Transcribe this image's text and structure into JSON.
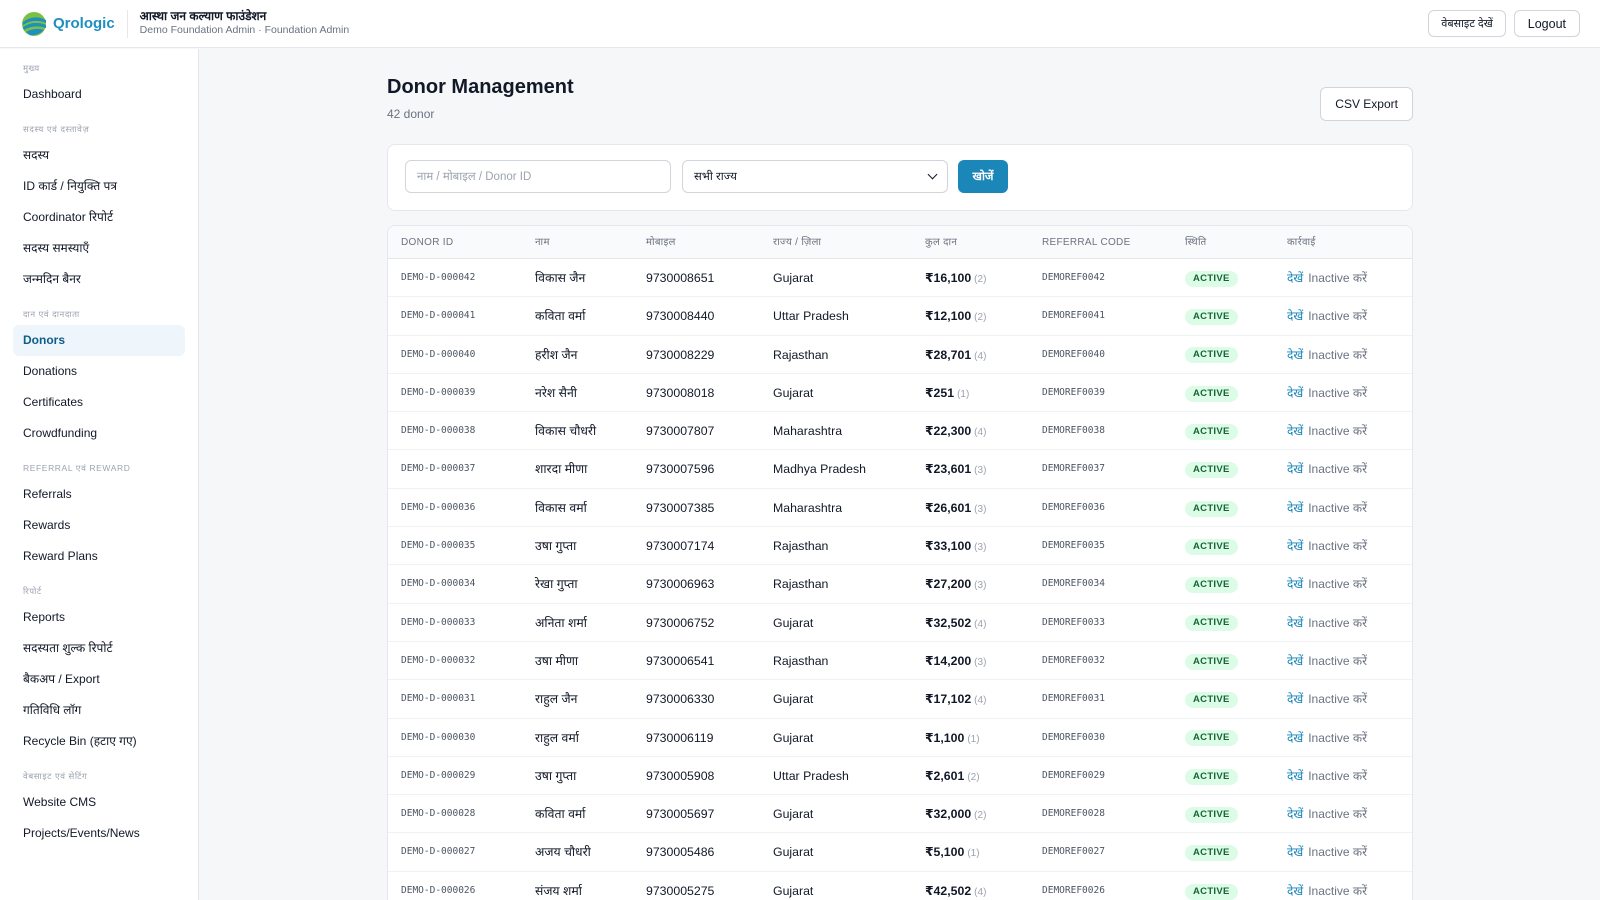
{
  "header": {
    "logo_text": "Qrologic",
    "org_name": "आस्था जन कल्याण फाउंडेशन",
    "org_role": "Demo Foundation Admin · Foundation Admin",
    "website_button": "वेबसाइट देखें",
    "logout_button": "Logout"
  },
  "sidebar": {
    "sections": [
      {
        "title": "मुख्य",
        "items": [
          {
            "label": "Dashboard",
            "active": false
          }
        ]
      },
      {
        "title": "सदस्य एवं दस्तावेज़",
        "items": [
          {
            "label": "सदस्य",
            "active": false
          },
          {
            "label": "ID कार्ड / नियुक्ति पत्र",
            "active": false
          },
          {
            "label": "Coordinator रिपोर्ट",
            "active": false
          },
          {
            "label": "सदस्य समस्याएँ",
            "active": false
          },
          {
            "label": "जन्मदिन बैनर",
            "active": false
          }
        ]
      },
      {
        "title": "दान एवं दानदाता",
        "items": [
          {
            "label": "Donors",
            "active": true
          },
          {
            "label": "Donations",
            "active": false
          },
          {
            "label": "Certificates",
            "active": false
          },
          {
            "label": "Crowdfunding",
            "active": false
          }
        ]
      },
      {
        "title": "REFERRAL एवं REWARD",
        "items": [
          {
            "label": "Referrals",
            "active": false
          },
          {
            "label": "Rewards",
            "active": false
          },
          {
            "label": "Reward Plans",
            "active": false
          }
        ]
      },
      {
        "title": "रिपोर्ट",
        "items": [
          {
            "label": "Reports",
            "active": false
          },
          {
            "label": "सदस्यता शुल्क रिपोर्ट",
            "active": false
          },
          {
            "label": "बैकअप / Export",
            "active": false
          },
          {
            "label": "गतिविधि लॉग",
            "active": false
          },
          {
            "label": "Recycle Bin (हटाए गए)",
            "active": false
          }
        ]
      },
      {
        "title": "वेबसाइट एवं सेटिंग",
        "items": [
          {
            "label": "Website CMS",
            "active": false
          },
          {
            "label": "Projects/Events/News",
            "active": false
          }
        ]
      }
    ]
  },
  "page": {
    "title": "Donor Management",
    "subtitle": "42 donor",
    "csv_button": "CSV Export"
  },
  "filters": {
    "search_placeholder": "नाम / मोबाइल / Donor ID",
    "state_value": "सभी राज्य",
    "search_button": "खोजें"
  },
  "table": {
    "columns": [
      "DONOR ID",
      "नाम",
      "मोबाइल",
      "राज्य / ज़िला",
      "कुल दान",
      "REFERRAL CODE",
      "स्थिति",
      "कार्रवाई"
    ],
    "view_label": "देखें",
    "inactive_label": "Inactive करें",
    "rows": [
      {
        "id": "DEMO-D-000042",
        "name": "विकास जैन",
        "mobile": "9730008651",
        "state": "Gujarat",
        "amount": "₹16,100",
        "count": "(2)",
        "ref": "DEMOREF0042",
        "status": "ACTIVE"
      },
      {
        "id": "DEMO-D-000041",
        "name": "कविता वर्मा",
        "mobile": "9730008440",
        "state": "Uttar Pradesh",
        "amount": "₹12,100",
        "count": "(2)",
        "ref": "DEMOREF0041",
        "status": "ACTIVE"
      },
      {
        "id": "DEMO-D-000040",
        "name": "हरीश जैन",
        "mobile": "9730008229",
        "state": "Rajasthan",
        "amount": "₹28,701",
        "count": "(4)",
        "ref": "DEMOREF0040",
        "status": "ACTIVE"
      },
      {
        "id": "DEMO-D-000039",
        "name": "नरेश सैनी",
        "mobile": "9730008018",
        "state": "Gujarat",
        "amount": "₹251",
        "count": "(1)",
        "ref": "DEMOREF0039",
        "status": "ACTIVE"
      },
      {
        "id": "DEMO-D-000038",
        "name": "विकास चौधरी",
        "mobile": "9730007807",
        "state": "Maharashtra",
        "amount": "₹22,300",
        "count": "(4)",
        "ref": "DEMOREF0038",
        "status": "ACTIVE"
      },
      {
        "id": "DEMO-D-000037",
        "name": "शारदा मीणा",
        "mobile": "9730007596",
        "state": "Madhya Pradesh",
        "amount": "₹23,601",
        "count": "(3)",
        "ref": "DEMOREF0037",
        "status": "ACTIVE"
      },
      {
        "id": "DEMO-D-000036",
        "name": "विकास वर्मा",
        "mobile": "9730007385",
        "state": "Maharashtra",
        "amount": "₹26,601",
        "count": "(3)",
        "ref": "DEMOREF0036",
        "status": "ACTIVE"
      },
      {
        "id": "DEMO-D-000035",
        "name": "उषा गुप्ता",
        "mobile": "9730007174",
        "state": "Rajasthan",
        "amount": "₹33,100",
        "count": "(3)",
        "ref": "DEMOREF0035",
        "status": "ACTIVE"
      },
      {
        "id": "DEMO-D-000034",
        "name": "रेखा गुप्ता",
        "mobile": "9730006963",
        "state": "Rajasthan",
        "amount": "₹27,200",
        "count": "(3)",
        "ref": "DEMOREF0034",
        "status": "ACTIVE"
      },
      {
        "id": "DEMO-D-000033",
        "name": "अनिता शर्मा",
        "mobile": "9730006752",
        "state": "Gujarat",
        "amount": "₹32,502",
        "count": "(4)",
        "ref": "DEMOREF0033",
        "status": "ACTIVE"
      },
      {
        "id": "DEMO-D-000032",
        "name": "उषा मीणा",
        "mobile": "9730006541",
        "state": "Rajasthan",
        "amount": "₹14,200",
        "count": "(3)",
        "ref": "DEMOREF0032",
        "status": "ACTIVE"
      },
      {
        "id": "DEMO-D-000031",
        "name": "राहुल जैन",
        "mobile": "9730006330",
        "state": "Gujarat",
        "amount": "₹17,102",
        "count": "(4)",
        "ref": "DEMOREF0031",
        "status": "ACTIVE"
      },
      {
        "id": "DEMO-D-000030",
        "name": "राहुल वर्मा",
        "mobile": "9730006119",
        "state": "Gujarat",
        "amount": "₹1,100",
        "count": "(1)",
        "ref": "DEMOREF0030",
        "status": "ACTIVE"
      },
      {
        "id": "DEMO-D-000029",
        "name": "उषा गुप्ता",
        "mobile": "9730005908",
        "state": "Uttar Pradesh",
        "amount": "₹2,601",
        "count": "(2)",
        "ref": "DEMOREF0029",
        "status": "ACTIVE"
      },
      {
        "id": "DEMO-D-000028",
        "name": "कविता वर्मा",
        "mobile": "9730005697",
        "state": "Gujarat",
        "amount": "₹32,000",
        "count": "(2)",
        "ref": "DEMOREF0028",
        "status": "ACTIVE"
      },
      {
        "id": "DEMO-D-000027",
        "name": "अजय चौधरी",
        "mobile": "9730005486",
        "state": "Gujarat",
        "amount": "₹5,100",
        "count": "(1)",
        "ref": "DEMOREF0027",
        "status": "ACTIVE"
      },
      {
        "id": "DEMO-D-000026",
        "name": "संजय शर्मा",
        "mobile": "9730005275",
        "state": "Gujarat",
        "amount": "₹42,502",
        "count": "(4)",
        "ref": "DEMOREF0026",
        "status": "ACTIVE"
      }
    ]
  },
  "colors": {
    "accent": "#1b86b8",
    "active_nav_bg": "#eef5fb",
    "badge_bg": "#dcfce7",
    "badge_text": "#166534"
  }
}
